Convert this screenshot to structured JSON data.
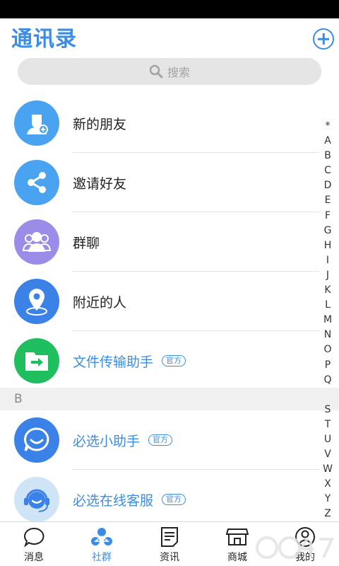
{
  "header": {
    "title": "通讯录"
  },
  "search": {
    "placeholder": "搜索"
  },
  "contacts": [
    {
      "label": "新的朋友",
      "icon": "new-friend-icon",
      "color": "#4aa3f0"
    },
    {
      "label": "邀请好友",
      "icon": "share-icon",
      "color": "#4aa3f0"
    },
    {
      "label": "群聊",
      "icon": "group-icon",
      "color": "#9b8ce8"
    },
    {
      "label": "附近的人",
      "icon": "location-pin-icon",
      "color": "#3b82e8"
    },
    {
      "label": "文件传输助手",
      "icon": "folder-icon",
      "color": "#1fbe5e",
      "badge": "官方"
    }
  ],
  "section_b": {
    "letter": "B"
  },
  "section_b_items": [
    {
      "label": "必选小助手",
      "icon": "chat-bubble-icon",
      "color": "#3b82e8",
      "badge": "官方"
    },
    {
      "label": "必选在线客服",
      "icon": "headset-icon",
      "color": "#cfe4f7",
      "badge": "官方"
    }
  ],
  "index": [
    "*",
    "A",
    "B",
    "C",
    "D",
    "E",
    "F",
    "G",
    "H",
    "I",
    "J",
    "K",
    "L",
    "M",
    "N",
    "O",
    "P",
    "Q",
    "",
    "S",
    "T",
    "U",
    "V",
    "W",
    "X",
    "Y",
    "Z"
  ],
  "tabs": [
    {
      "label": "消息",
      "icon": "message-icon",
      "active": false
    },
    {
      "label": "社群",
      "icon": "community-icon",
      "active": true
    },
    {
      "label": "资讯",
      "icon": "news-icon",
      "active": false
    },
    {
      "label": "商城",
      "icon": "shop-icon",
      "active": false
    },
    {
      "label": "我的",
      "icon": "profile-icon",
      "active": false
    }
  ],
  "colors": {
    "accent": "#3b8de3"
  }
}
